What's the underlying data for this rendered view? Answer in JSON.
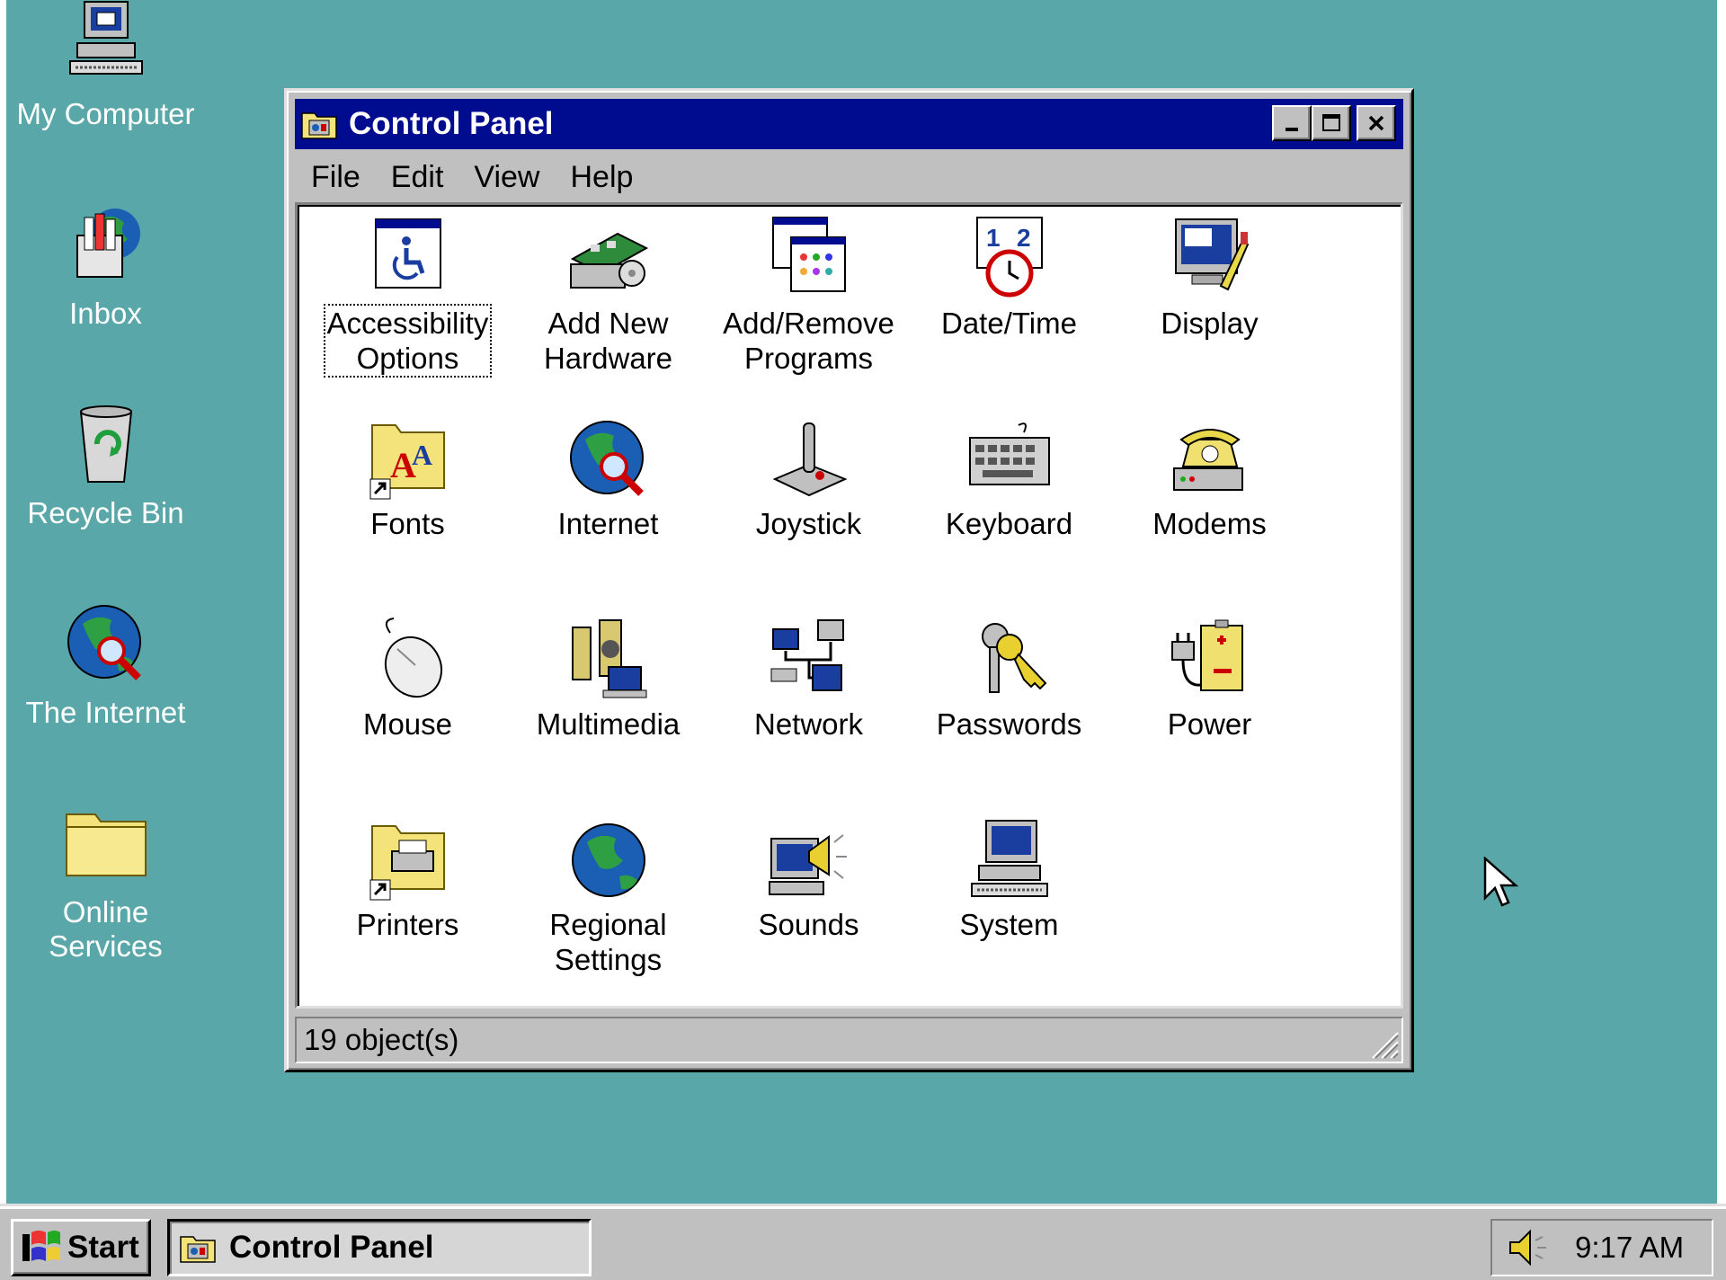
{
  "desktop": {
    "icons": [
      {
        "label": "My Computer",
        "icon": "my-computer-icon"
      },
      {
        "label": "Inbox",
        "icon": "inbox-icon"
      },
      {
        "label": "Recycle Bin",
        "icon": "recycle-bin-icon"
      },
      {
        "label": "The Internet",
        "icon": "globe-icon"
      },
      {
        "label": "Online\nServices",
        "icon": "folder-icon"
      }
    ]
  },
  "window": {
    "title": "Control Panel",
    "menu": [
      "File",
      "Edit",
      "View",
      "Help"
    ],
    "items": [
      {
        "label": "Accessibility\nOptions",
        "icon": "accessibility-icon"
      },
      {
        "label": "Add New\nHardware",
        "icon": "hardware-icon"
      },
      {
        "label": "Add/Remove\nPrograms",
        "icon": "programs-icon"
      },
      {
        "label": "Date/Time",
        "icon": "clock-icon"
      },
      {
        "label": "Display",
        "icon": "display-icon"
      },
      {
        "label": "Fonts",
        "icon": "fonts-icon"
      },
      {
        "label": "Internet",
        "icon": "internet-icon"
      },
      {
        "label": "Joystick",
        "icon": "joystick-icon"
      },
      {
        "label": "Keyboard",
        "icon": "keyboard-icon"
      },
      {
        "label": "Modems",
        "icon": "modem-icon"
      },
      {
        "label": "Mouse",
        "icon": "mouse-icon"
      },
      {
        "label": "Multimedia",
        "icon": "multimedia-icon"
      },
      {
        "label": "Network",
        "icon": "network-icon"
      },
      {
        "label": "Passwords",
        "icon": "keys-icon"
      },
      {
        "label": "Power",
        "icon": "power-icon"
      },
      {
        "label": "Printers",
        "icon": "printers-icon"
      },
      {
        "label": "Regional\nSettings",
        "icon": "globe-icon"
      },
      {
        "label": "Sounds",
        "icon": "sounds-icon"
      },
      {
        "label": "System",
        "icon": "system-icon"
      }
    ],
    "status": "19 object(s)"
  },
  "taskbar": {
    "start_label": "Start",
    "task_label": "Control Panel",
    "clock": "9:17 AM"
  },
  "colors": {
    "desktop": "#5aa7a9",
    "titlebar": "#000c8f",
    "face": "#c0c0c0"
  }
}
